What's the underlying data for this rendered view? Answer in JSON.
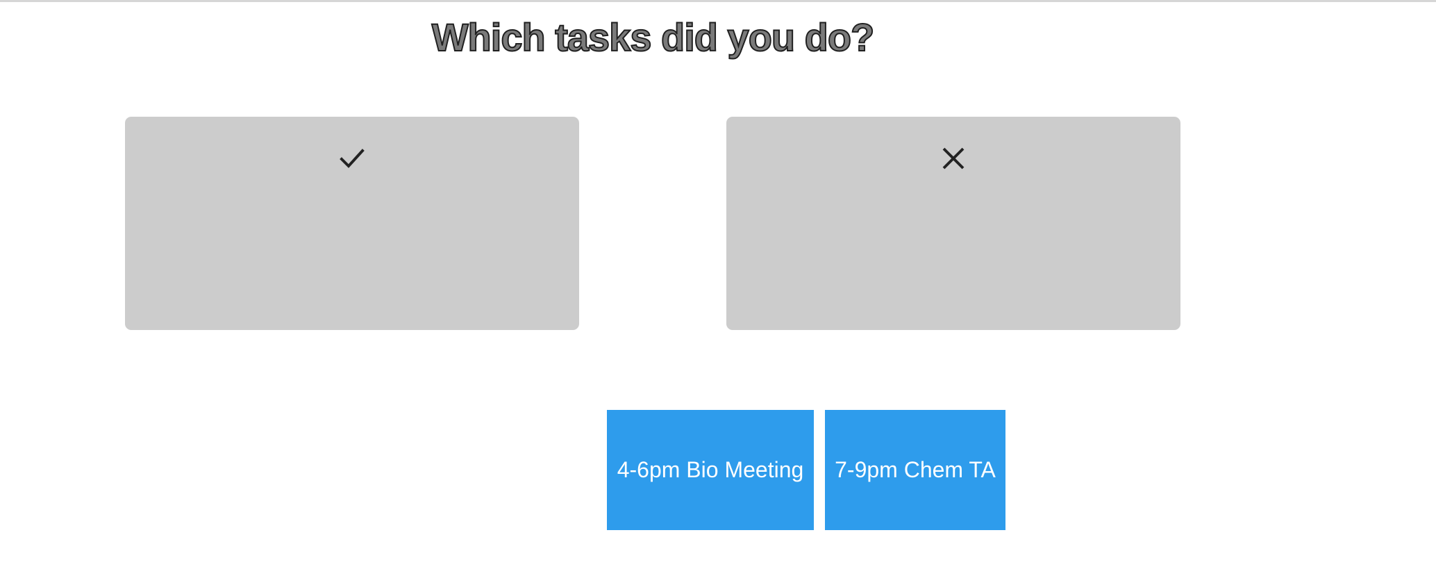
{
  "page": {
    "title": "Which tasks did you do?"
  },
  "zones": [
    {
      "icon": "check-icon",
      "meaning": "done"
    },
    {
      "icon": "close-icon",
      "meaning": "not-done"
    }
  ],
  "tasks": [
    {
      "label": "4-6pm Bio Meeting"
    },
    {
      "label": "7-9pm Chem TA"
    }
  ],
  "colors": {
    "zone_background": "#cccccc",
    "chip_background": "#2e9cec",
    "chip_text": "#ffffff",
    "icon": "#222222"
  }
}
